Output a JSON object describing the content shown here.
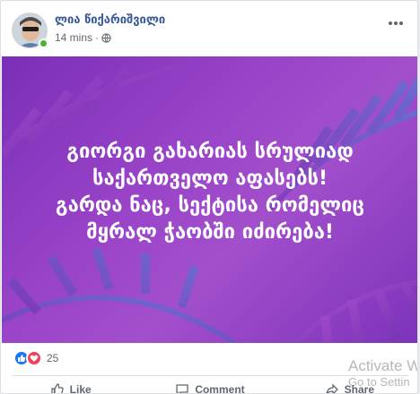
{
  "post": {
    "author": "ლია წიქარიშვილი",
    "time": "14 mins",
    "privacy_icon": "globe-icon",
    "more_icon": "more-options-icon"
  },
  "image": {
    "background": "#8a3cc0",
    "text_lines": [
      "გიორგი გახარიას სრულიად",
      "საქართველო აფასებს!",
      "გარდა ნაც, სექტისა რომელიც",
      "მყრალ ჭაობში იძირება!"
    ]
  },
  "reactions": {
    "count": "25",
    "icons": [
      "like-icon",
      "love-icon"
    ]
  },
  "actions": {
    "like": "Like",
    "comment": "Comment",
    "share": "Share"
  },
  "watermark": {
    "line1": "Activate W",
    "line2": "Go to Settin"
  },
  "colors": {
    "accent": "#385898",
    "like_blue": "#1877f2",
    "love_red": "#f33e58",
    "purple": "#8a3cc0"
  }
}
